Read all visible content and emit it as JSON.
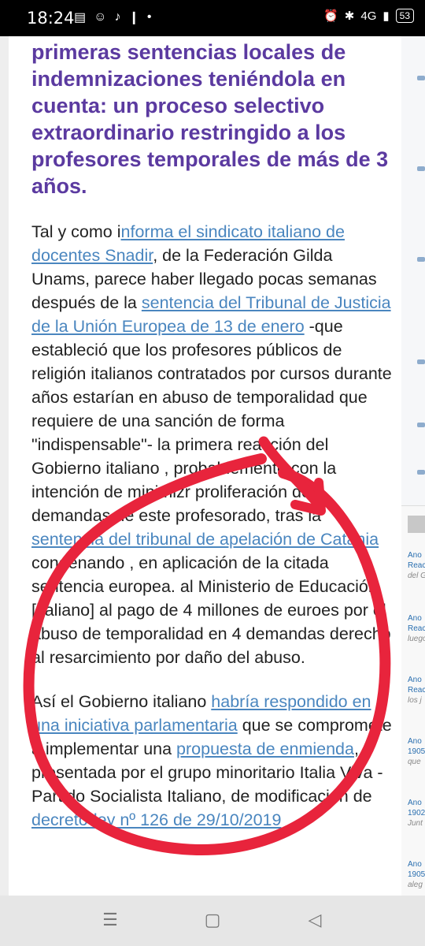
{
  "status_bar": {
    "time": "18:24",
    "network": "4G",
    "battery": "53"
  },
  "article": {
    "heading": "primeras sentencias locales de indemnizaciones teniéndola en cuenta: un proceso selectivo extraordinario restringido a los profesores temporales de más de 3 años.",
    "p1": {
      "t1": "Tal y como i",
      "link1": "nforma el sindicato italiano de docentes Snadir",
      "t2": ", de la Federación Gilda Unams, parece haber llegado pocas semanas después de  la ",
      "link2": "sentencia del Tribunal de Justicia de la Unión Europea de 13 de enero",
      "t3": " -que estableció que los profesores públicos de religión italianos contratados por cursos durante años estarían en abuso de temporalidad que requiere de una sanción de forma \"indispensable\"- la primera reacción del Gobierno italiano , probablemente con la intención de minimizr proliferación de demandas de este profesorado, tras la ",
      "link3": "sentencia del tribunal de apelación de Catania",
      "t4": "  condenando , en aplicación de la citada sentencia europea. al Ministerio de Educación [italiano] al pago de 4 millones de euroes por el abuso de temporalidad en 4 demandas  derecho al resarcimiento por daño del abuso."
    },
    "p2": {
      "t1": "Así el Gobierno italiano ",
      "link1": "habría respondido en una iniciativa parlamentaria",
      "t2": " que se compromete a implementar una ",
      "link2": "propuesta de enmienda",
      "t3": ", presentada por el grupo minoritario Italia Viva - Partido Socialista Italiano, de modificación de ",
      "link3": "decreto-ley nº 126 de 29/10/2019"
    }
  },
  "sidebar": {
    "entries": [
      {
        "a": "Ano",
        "b": "Reac",
        "c": "del G"
      },
      {
        "a": "Ano",
        "b": "Reac",
        "c": "luego"
      },
      {
        "a": "Ano",
        "b": "Reac",
        "c": "los j"
      },
      {
        "a": "Ano",
        "b": "1905",
        "c": "que"
      },
      {
        "a": "Ano",
        "b": "1902",
        "c": "Junt"
      },
      {
        "a": "Ano",
        "b": "1905",
        "c": "aleg"
      }
    ]
  },
  "colors": {
    "heading": "#5b3aa0",
    "link": "#4a86bf",
    "annotation": "#e8243c"
  },
  "icons": [
    "menu-icon",
    "home-icon",
    "back-icon"
  ]
}
